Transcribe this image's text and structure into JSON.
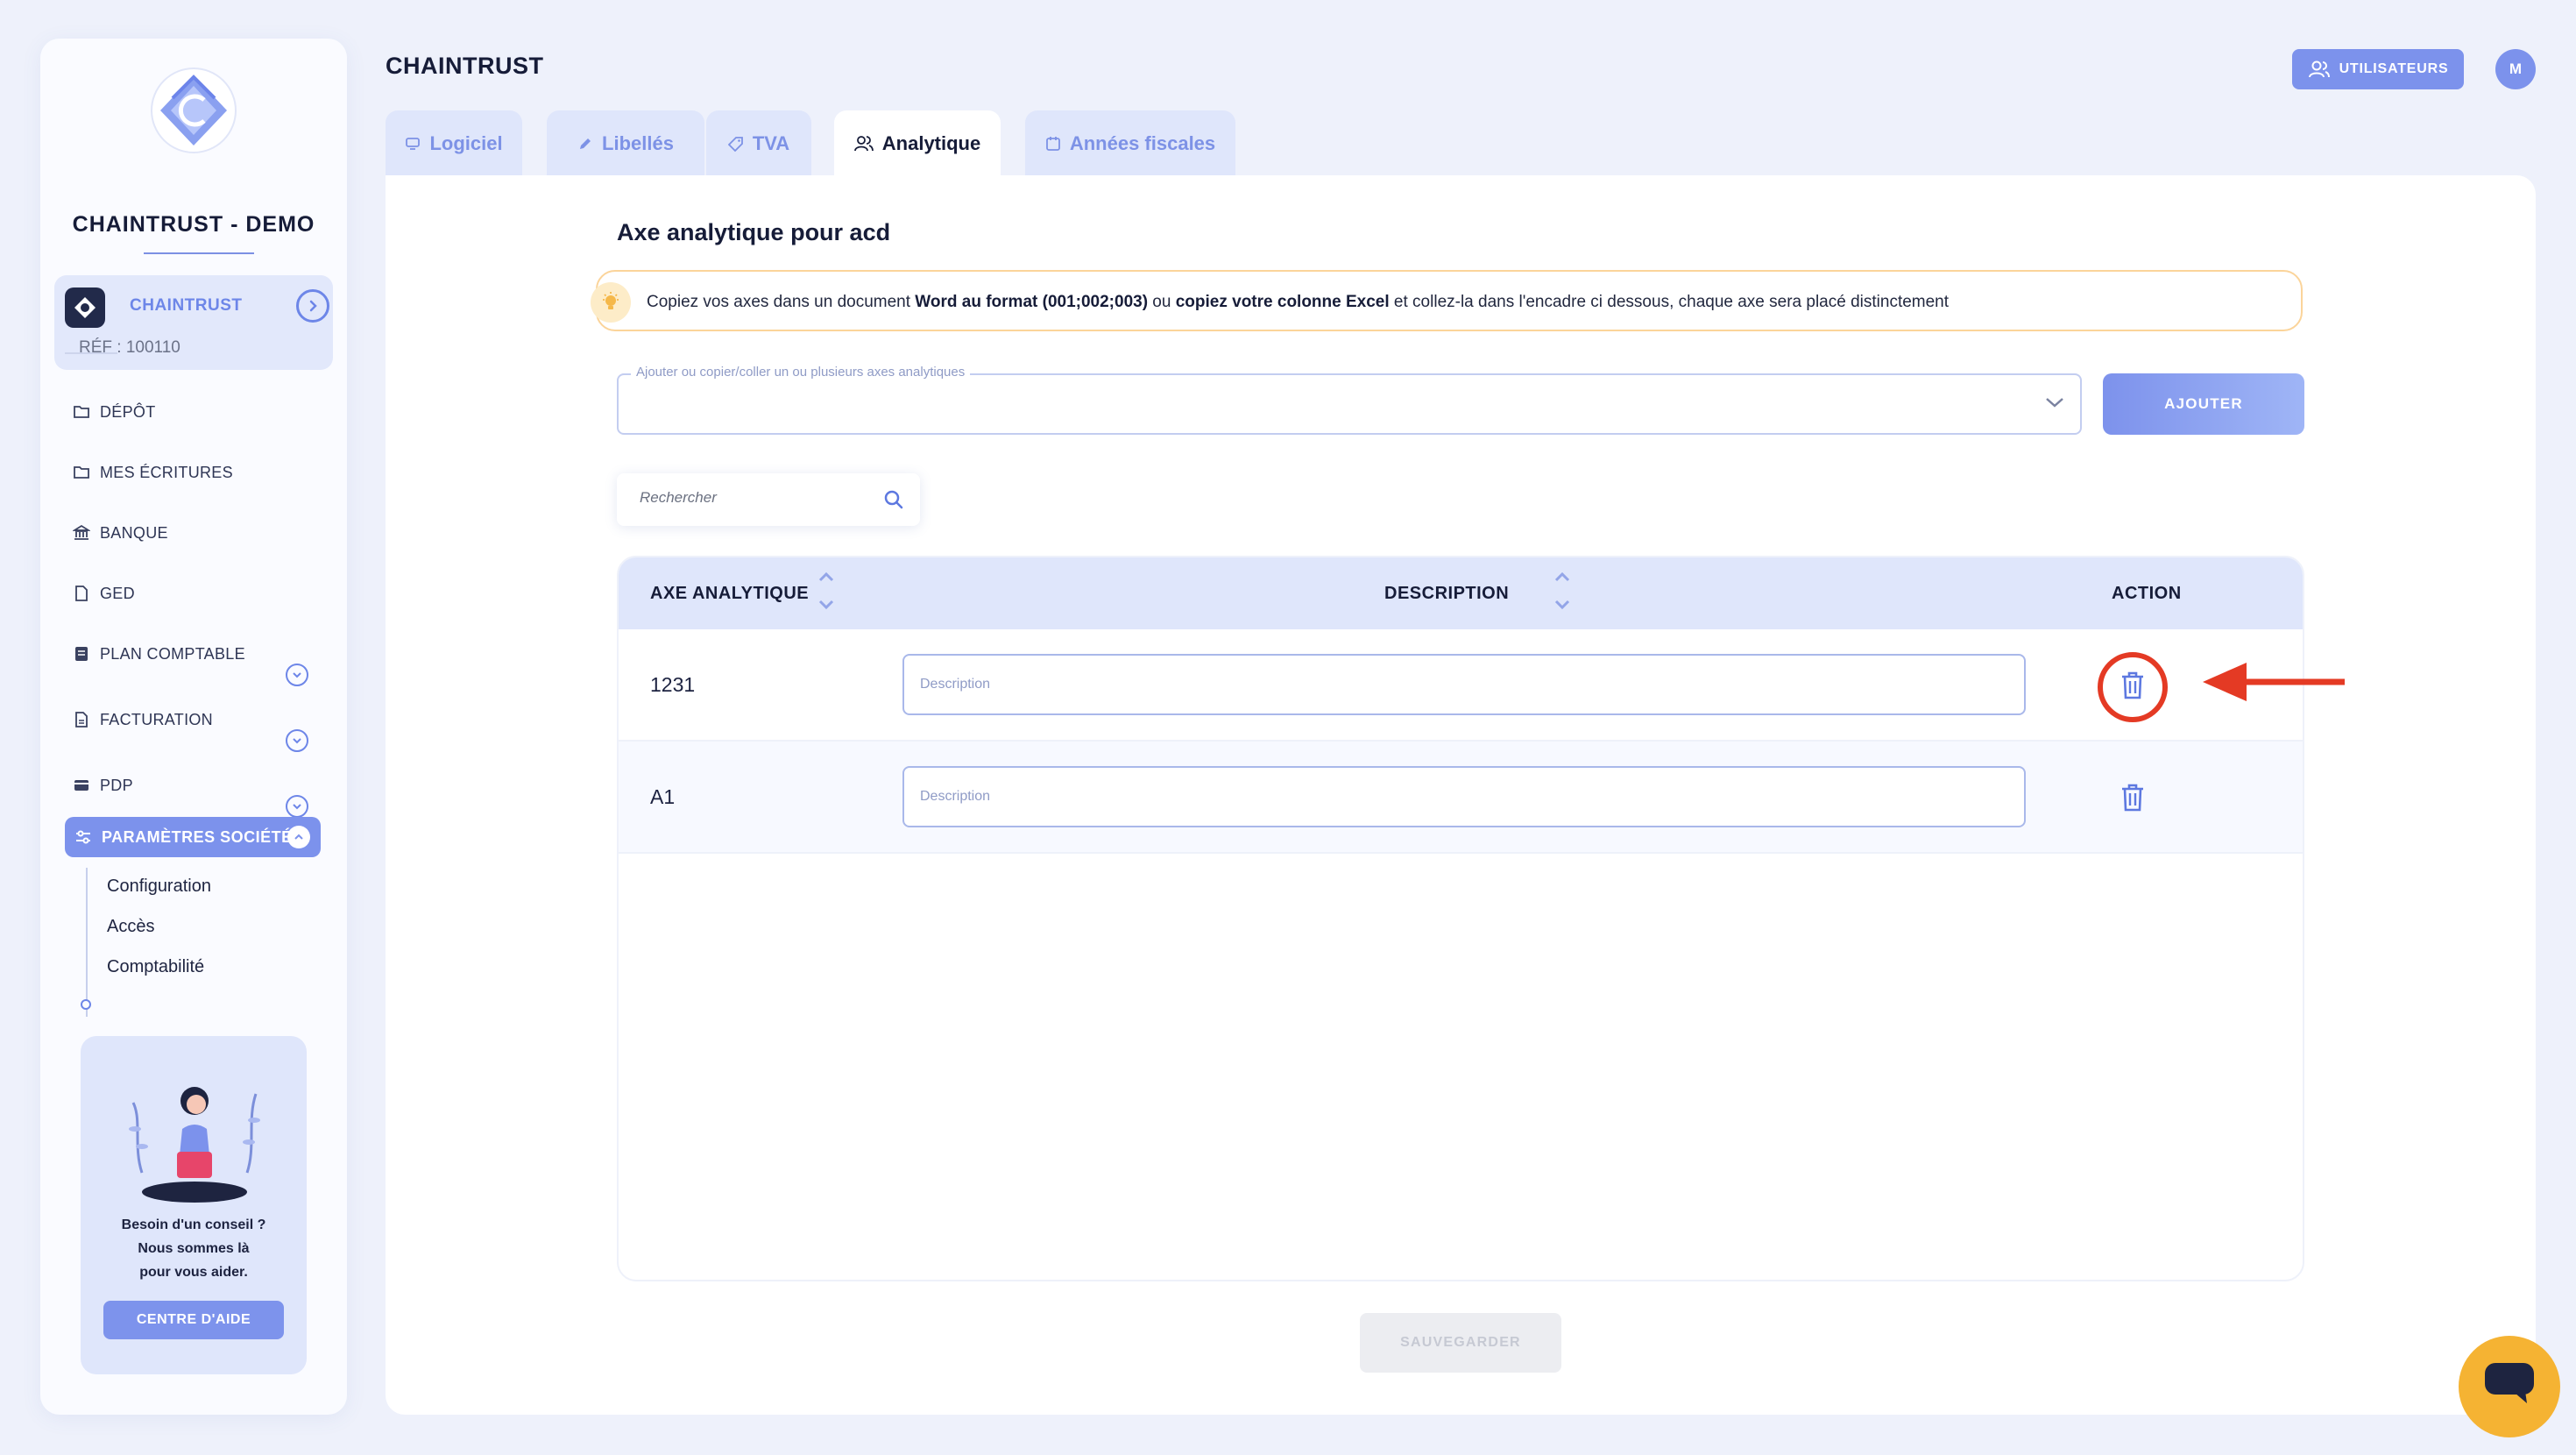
{
  "header": {
    "title": "CHAINTRUST",
    "users_label": "UTILISATEURS",
    "avatar_initial": "M"
  },
  "sidebar": {
    "company_name": "CHAINTRUST - DEMO",
    "org": {
      "name": "CHAINTRUST",
      "ref": "RÉF : 100110"
    },
    "items": [
      {
        "label": "DÉPÔT",
        "icon": "folder-icon"
      },
      {
        "label": "MES ÉCRITURES",
        "icon": "folder-edit-icon"
      },
      {
        "label": "BANQUE",
        "icon": "bank-icon"
      },
      {
        "label": "GED",
        "icon": "document-icon"
      },
      {
        "label": "PLAN COMPTABLE",
        "icon": "ledger-icon"
      },
      {
        "label": "FACTURATION",
        "icon": "invoice-icon"
      },
      {
        "label": "PDP",
        "icon": "card-icon"
      }
    ],
    "active_section": "PARAMÈTRES SOCIÉTÉ",
    "sub_items": [
      "Configuration",
      "Accès",
      "Comptabilité"
    ],
    "help": {
      "line1": "Besoin d'un conseil ?",
      "line2": "Nous sommes là",
      "line3": "pour vous aider.",
      "button": "CENTRE D'AIDE"
    }
  },
  "tabs": [
    {
      "label": "Logiciel",
      "icon": "monitor-icon"
    },
    {
      "label": "Libellés",
      "icon": "pen-icon"
    },
    {
      "label": "TVA",
      "icon": "tag-icon"
    },
    {
      "label": "Analytique",
      "icon": "users-icon",
      "active": true
    },
    {
      "label": "Années fiscales",
      "icon": "calendar-icon"
    }
  ],
  "main": {
    "section_title": "Axe analytique pour acd",
    "info": {
      "t1": "Copiez vos axes dans un document ",
      "b1": "Word au format (001;002;003)",
      "t2": " ou ",
      "b2": "copiez votre colonne Excel",
      "t3": " et collez-la dans l'encadre ci dessous, chaque axe sera placé distinctement"
    },
    "axis_field_label": "Ajouter ou copier/coller un ou plusieurs axes analytiques",
    "add_button": "AJOUTER",
    "search_placeholder": "Rechercher",
    "table": {
      "headers": {
        "axis": "AXE ANALYTIQUE",
        "description": "DESCRIPTION",
        "action": "ACTION"
      },
      "rows": [
        {
          "axis": "1231",
          "description_placeholder": "Description",
          "highlighted": true
        },
        {
          "axis": "A1",
          "description_placeholder": "Description",
          "highlighted": false
        }
      ]
    },
    "save_button": "SAUVEGARDER"
  },
  "colors": {
    "accent": "#7c92ec",
    "annotation": "#e43a24",
    "chat": "#f5b333"
  }
}
